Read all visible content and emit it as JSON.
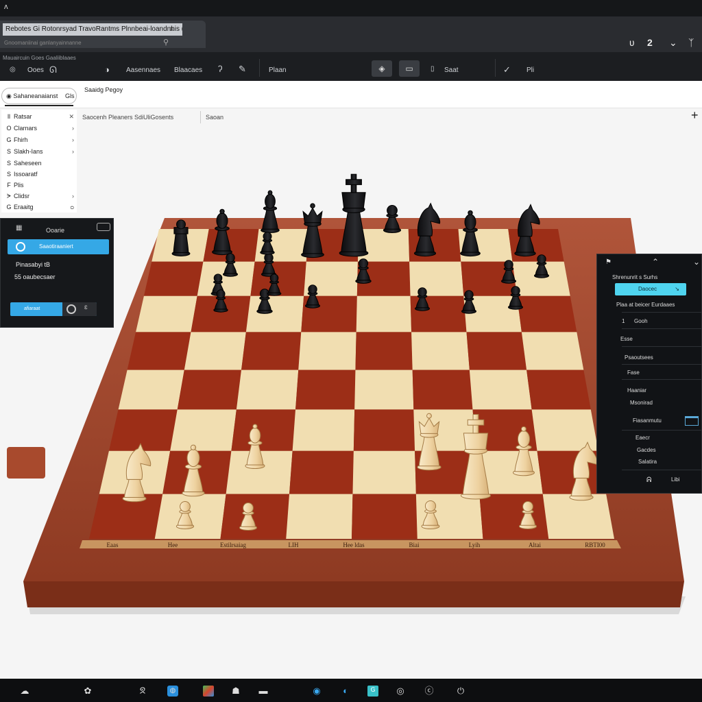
{
  "window": {
    "logo": "ᴧ",
    "tab_title": "Rebotes Gi Rotonrsyad TravoRantms Plnnbeai-loandnhis (J",
    "tab_close": "x",
    "address_hint": "Gnoomaniinai ganlanyainnanne",
    "controls": [
      "ʋ",
      "2",
      "⌄",
      "ᛉ"
    ]
  },
  "toolbar": {
    "breadcrumb": "Mauaircuin Goes Gaaliiblaaes",
    "items": [
      "Ooes",
      "Aasennaes",
      "Blaacaes",
      "Plaan",
      "Saat",
      "Pli"
    ]
  },
  "sidebar": {
    "search_value": "Sahaneanaianst",
    "search_suffix": "Gls",
    "items": [
      {
        "icon": "ll",
        "label": "Ratsar",
        "right": "✕"
      },
      {
        "icon": "O",
        "label": "Clarnars",
        "right": "›"
      },
      {
        "icon": "G",
        "label": "Fhirh",
        "right": "›"
      },
      {
        "icon": "S",
        "label": "Slakh-Ians",
        "right": "›"
      },
      {
        "icon": "S",
        "label": "Saheseen",
        "right": ""
      },
      {
        "icon": "S",
        "label": "Issoaratf",
        "right": ""
      },
      {
        "icon": "F",
        "label": "Plis",
        "right": ""
      },
      {
        "icon": "ᗒ",
        "label": "Clidsr",
        "right": "›"
      },
      {
        "icon": "G",
        "label": "Eraaitg",
        "right": "ᴑ"
      }
    ]
  },
  "header": {
    "subtitle": "Saaidg Pegoy",
    "board_info": "Saocenh Pleaners SdiUliGosents",
    "filter": "Saoan",
    "add": "+"
  },
  "left_panel": {
    "title": "Ooarie",
    "primary_button": "Saaotiraaniert",
    "line1": "Pinasabyi tB",
    "line2": "55 oaubecsaer",
    "action_button": "afiaraat",
    "action_glyph": "ɛ"
  },
  "right_panel": {
    "header": "Shrenunrit s Surhs",
    "button": "Daocec",
    "button_arrow": "↘",
    "subtitle": "Plaa at beicer Eurdaaes",
    "rows": [
      {
        "num": "1",
        "label": "Gooh"
      },
      {
        "num": "",
        "label": "Esse"
      },
      {
        "num": "",
        "label": "Psaoutsees"
      },
      {
        "num": "",
        "label": "Fase"
      },
      {
        "num": "",
        "label": "Haaniar"
      },
      {
        "num": "",
        "label": "Msonirad"
      },
      {
        "num": "",
        "label": "Fiasanmutu"
      },
      {
        "num": "",
        "label": "Eaecr"
      },
      {
        "num": "",
        "label": "Gacdes"
      },
      {
        "num": "",
        "label": "Salatira"
      }
    ],
    "footer_left": "ᕱ",
    "footer_right": "Libi"
  },
  "board": {
    "files": [
      "Eaas",
      "Hee",
      "Estilrsaiag",
      "LIH",
      "Hee ldas",
      "Biai",
      "Lyih",
      "Altai",
      "RBTI00"
    ],
    "light_color": "#f1deb1",
    "dark_color": "#9c2e17",
    "frame_color": "#a4492d"
  },
  "pieces": {
    "black": [
      "rook",
      "bishop",
      "queen",
      "bishop",
      "king",
      "pawn",
      "knight",
      "bishop",
      "knight",
      "pawn",
      "pawn",
      "pawn",
      "pawn",
      "pawn",
      "pawn",
      "pawn",
      "pawn",
      "pawn",
      "pawn",
      "pawn",
      "pawn",
      "pawn",
      "pawn"
    ],
    "white": [
      "knight",
      "bishop",
      "bishop",
      "queen",
      "king",
      "bishop",
      "knight",
      "pawn",
      "pawn",
      "pawn",
      "pawn"
    ]
  },
  "taskbar": {
    "icons": [
      "cloud-icon",
      "settings-icon",
      "chart-icon",
      "browser-icon",
      "photos-icon",
      "store-icon",
      "steam-icon",
      "chrome-icon",
      "files-icon",
      "edge-icon",
      "spotify-icon",
      "mail-icon"
    ]
  }
}
